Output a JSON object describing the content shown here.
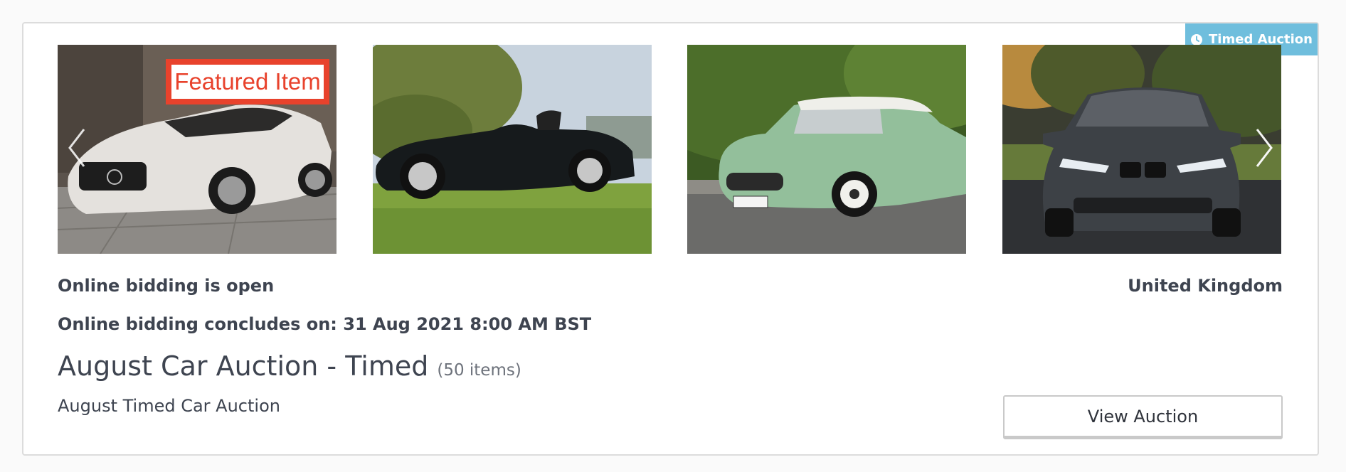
{
  "badge": {
    "label": "Timed Auction",
    "icon": "clock-icon",
    "color": "#6fbedd"
  },
  "gallery": {
    "featured_label": "Featured Item",
    "images": [
      {
        "name": "white-gullwing-coupe"
      },
      {
        "name": "black-convertible-roadster"
      },
      {
        "name": "green-retro-coupe"
      },
      {
        "name": "grey-sports-sedan"
      }
    ]
  },
  "auction": {
    "status": "Online bidding is open",
    "location": "United Kingdom",
    "concludes": "Online bidding concludes on: 31 Aug 2021 8:00 AM BST",
    "title": "August Car Auction - Timed",
    "item_count": "(50 items)",
    "description": "August Timed Car Auction",
    "view_button": "View Auction"
  },
  "colors": {
    "text": "#3e4450",
    "featured": "#e8422c",
    "border": "#dcdcdc"
  }
}
